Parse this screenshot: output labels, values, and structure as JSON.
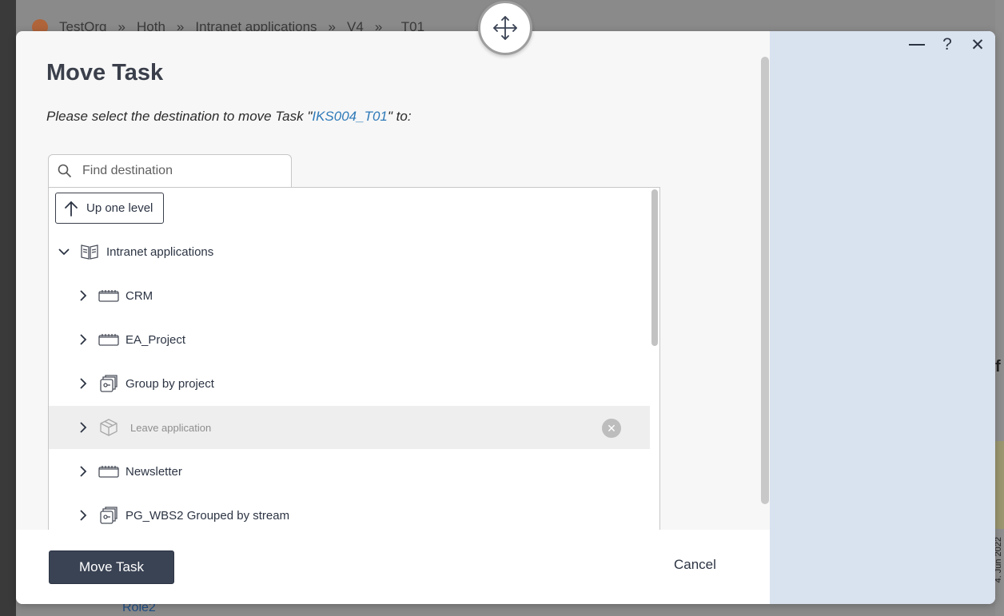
{
  "background": {
    "breadcrumbs": [
      "TestOrg",
      "»",
      "Hoth",
      "»",
      "Intranet applications",
      "»",
      "V4",
      "»",
      "_T01"
    ],
    "bottom_text": "Role2",
    "right_letter": "f",
    "right_date": "4. Jun 2022"
  },
  "dialog": {
    "title": "Move Task",
    "subtitle_prefix": "Please select the destination to move Task \"",
    "task_name": "IKS004_T01",
    "subtitle_suffix": "\" to:",
    "search": {
      "placeholder": "Find destination",
      "value": ""
    },
    "up_button_label": "Up one level",
    "tree": {
      "root": {
        "label": "Intranet applications",
        "icon": "book-icon",
        "expanded": true
      },
      "children": [
        {
          "label": "CRM",
          "icon": "product-icon",
          "disabled": false
        },
        {
          "label": "EA_Project",
          "icon": "product-icon",
          "disabled": false
        },
        {
          "label": "Group by project",
          "icon": "stack-icon",
          "disabled": false
        },
        {
          "label": "Leave application",
          "icon": "package-icon",
          "disabled": true
        },
        {
          "label": "Newsletter",
          "icon": "product-icon",
          "disabled": false
        },
        {
          "label": "PG_WBS2 Grouped by stream",
          "icon": "stack-icon",
          "disabled": false
        }
      ]
    },
    "footer": {
      "move_label": "Move Task",
      "cancel_label": "Cancel"
    },
    "window_controls": {
      "minimize": "minimize-icon",
      "help": "?",
      "close": "✕"
    }
  },
  "colors": {
    "accent_dark": "#3a4354",
    "link": "#2f7ab8",
    "side_panel": "#d9e2ef"
  }
}
